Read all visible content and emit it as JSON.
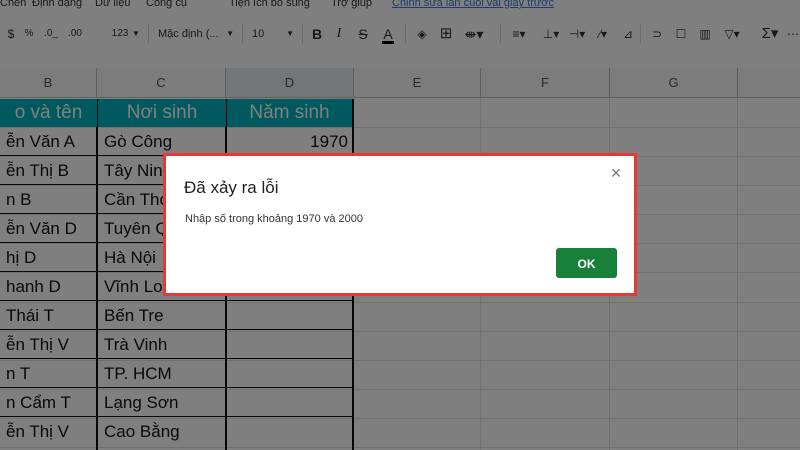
{
  "menu": {
    "items": [
      "Chèn",
      "Định dạng",
      "Dữ liệu",
      "Công cụ",
      "Tiện ích bổ sung",
      "Trợ giúp"
    ],
    "last_edit": "Chỉnh sửa lần cuối vài giây trước"
  },
  "toolbar": {
    "percent": "%",
    "decrease_decimal": ".0_",
    "increase_decimal": ".00",
    "more_formats": "123",
    "font": "Mặc định (...",
    "font_size": "10",
    "bold": "B",
    "italic": "I",
    "strike": "S",
    "text_color": "A",
    "sum": "Σ"
  },
  "columns": {
    "B": "B",
    "C": "C",
    "D": "D",
    "E": "E",
    "F": "F",
    "G": "G"
  },
  "table": {
    "headers": [
      "o và tên",
      "Nơi sinh",
      "Năm sinh"
    ],
    "rows": [
      {
        "name": "ễn Văn A",
        "place": "Gò Công",
        "year": "1970"
      },
      {
        "name": "ễn Thị B",
        "place": "Tây Nin",
        "year": ""
      },
      {
        "name": "n B",
        "place": "Cần Thơ",
        "year": ""
      },
      {
        "name": "ễn Văn D",
        "place": "Tuyên Q",
        "year": ""
      },
      {
        "name": "hị D",
        "place": "Hà Nội",
        "year": ""
      },
      {
        "name": "hanh D",
        "place": "Vĩnh Long",
        "year": ""
      },
      {
        "name": "Thái T",
        "place": "Bến Tre",
        "year": ""
      },
      {
        "name": "ễn Thị V",
        "place": "Trà Vinh",
        "year": ""
      },
      {
        "name": "n T",
        "place": "TP. HCM",
        "year": ""
      },
      {
        "name": "n Cẩm T",
        "place": "Lạng Sơn",
        "year": ""
      },
      {
        "name": "ễn Thị V",
        "place": "Cao Bằng",
        "year": ""
      }
    ]
  },
  "dialog": {
    "title": "Đã xảy ra lỗi",
    "message": "Nhập số trong khoảng 1970 và 2000",
    "ok_label": "OK",
    "close_icon": "close-icon"
  },
  "colors": {
    "header_fill": "#00b3bd",
    "dialog_border": "#e53935",
    "ok_button": "#188038",
    "link": "#3c78d8"
  }
}
